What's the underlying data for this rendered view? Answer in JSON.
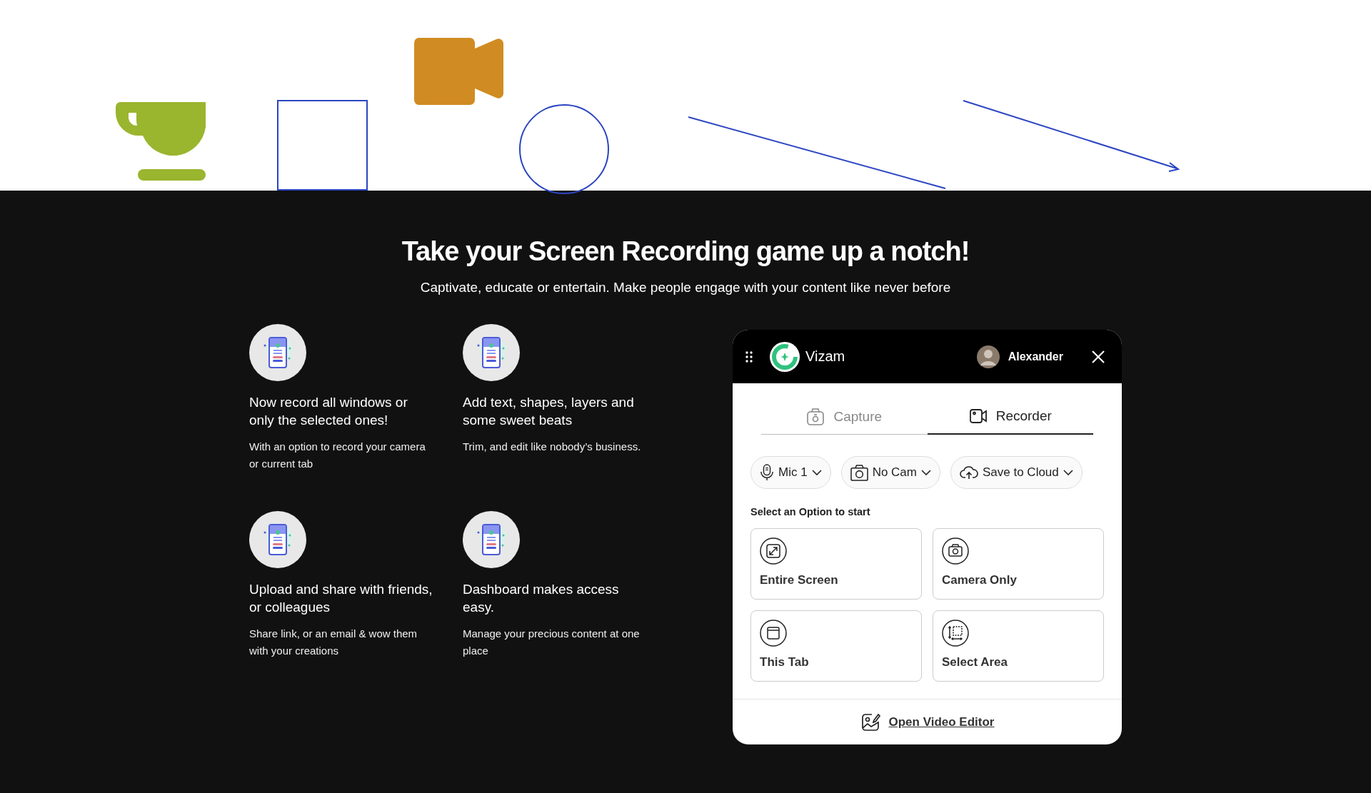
{
  "heading": "Take your Screen Recording game up a notch!",
  "subheading": "Captivate, educate or entertain. Make people engage with your content like never before",
  "features": [
    {
      "title": "Now record all windows or only the selected ones!",
      "description": "With an option to record your camera or current tab"
    },
    {
      "title": "Add text, shapes, layers and some sweet beats",
      "description": "Trim, and edit like nobody’s business."
    },
    {
      "title": "Upload and share with friends, or colleagues",
      "description": "Share link, or an email & wow them with your creations"
    },
    {
      "title": "Dashboard makes access easy.",
      "description": "Manage your precious content at one place"
    }
  ],
  "widget": {
    "app_name": "Vizam",
    "user_name": "Alexander",
    "tabs": [
      {
        "label": "Capture",
        "kind": "capture",
        "selected": false
      },
      {
        "label": "Recorder",
        "kind": "recorder",
        "selected": true
      }
    ],
    "dropdowns": [
      {
        "label": "Mic 1",
        "kind": "mic"
      },
      {
        "label": "No Cam",
        "kind": "cam"
      },
      {
        "label": "Save to Cloud",
        "kind": "cloud"
      }
    ],
    "prompt": "Select an Option to start",
    "options": [
      {
        "label": "Entire Screen",
        "kind": "screen"
      },
      {
        "label": "Camera Only",
        "kind": "camera"
      },
      {
        "label": "This Tab",
        "kind": "tab"
      },
      {
        "label": "Select Area",
        "kind": "area"
      }
    ],
    "editor_link": "Open Video Editor"
  }
}
